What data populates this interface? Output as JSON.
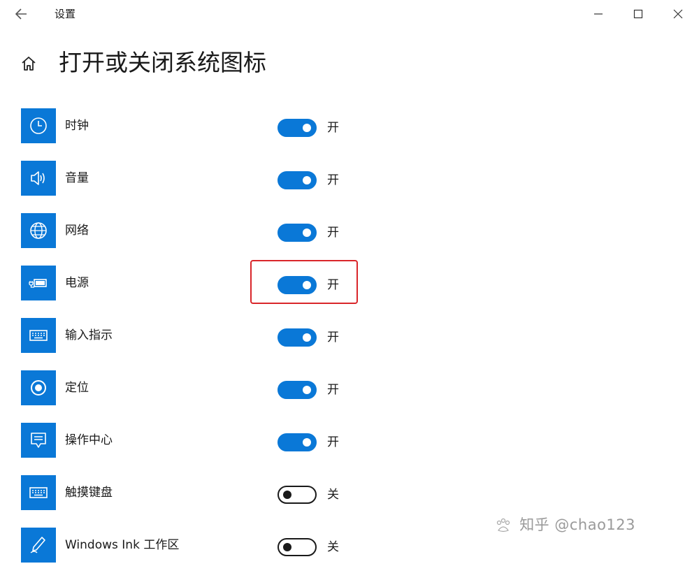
{
  "window": {
    "app_title": "设置"
  },
  "page": {
    "title": "打开或关闭系统图标"
  },
  "colors": {
    "accent": "#0a78d7",
    "highlight": "#d9262a"
  },
  "items": [
    {
      "label": "时钟",
      "icon": "clock-icon",
      "state": "开",
      "on": true
    },
    {
      "label": "音量",
      "icon": "volume-icon",
      "state": "开",
      "on": true
    },
    {
      "label": "网络",
      "icon": "network-globe-icon",
      "state": "开",
      "on": true
    },
    {
      "label": "电源",
      "icon": "power-battery-icon",
      "state": "开",
      "on": true
    },
    {
      "label": "输入指示",
      "icon": "keyboard-icon",
      "state": "开",
      "on": true
    },
    {
      "label": "定位",
      "icon": "location-icon",
      "state": "开",
      "on": true
    },
    {
      "label": "操作中心",
      "icon": "action-center-icon",
      "state": "开",
      "on": true
    },
    {
      "label": "触摸键盘",
      "icon": "touch-keyboard-icon",
      "state": "关",
      "on": false
    },
    {
      "label": "Windows Ink 工作区",
      "icon": "windows-ink-pen-icon",
      "state": "关",
      "on": false
    }
  ],
  "watermark": {
    "text": "知乎 @chao123"
  }
}
